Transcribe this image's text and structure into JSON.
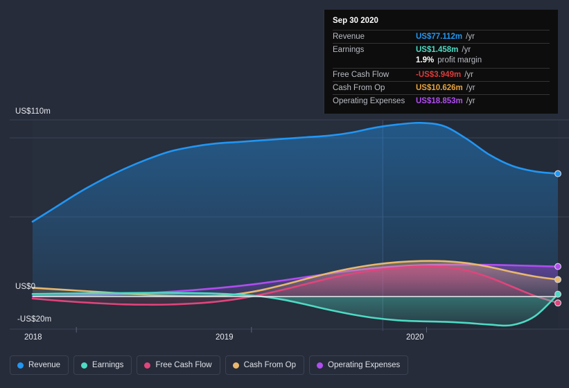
{
  "chart_data": {
    "type": "area",
    "title": "",
    "xlabel": "",
    "ylabel": "",
    "grid": true,
    "legend_position": "bottom",
    "currency": "US$",
    "units": "m",
    "ylim": [
      -20,
      110
    ],
    "y_ticks": [
      {
        "label": "US$110m",
        "value": 110
      },
      {
        "label": "US$0",
        "value": 0
      },
      {
        "label": "-US$20m",
        "value": -20
      }
    ],
    "x_ticks": [
      {
        "label": "2018",
        "value": 2018
      },
      {
        "label": "2019",
        "value": 2019
      },
      {
        "label": "2020",
        "value": 2020
      }
    ],
    "x_range": [
      "2017-10",
      "2020-09"
    ],
    "forecast_divider_x": 2019.75,
    "series": [
      {
        "name": "Revenue",
        "color": "#2196f3",
        "last_value": 77.112,
        "values": [
          47,
          56,
          65,
          73,
          80,
          86,
          91,
          94,
          96,
          97,
          98,
          99,
          100,
          101,
          103,
          106,
          108,
          109,
          107,
          99,
          89,
          82,
          78.5,
          77.112
        ]
      },
      {
        "name": "Earnings",
        "color": "#4ddbc4",
        "last_value": 1.458,
        "values": [
          1.6,
          1.8,
          2.0,
          2.1,
          2.2,
          2.3,
          2.3,
          2.2,
          1.9,
          1.2,
          0.1,
          -2.0,
          -5.0,
          -8.2,
          -11.0,
          -13.2,
          -14.6,
          -15.2,
          -15.5,
          -16.2,
          -17.2,
          -17.5,
          -12.0,
          1.458
        ]
      },
      {
        "name": "Free Cash Flow",
        "color": "#e0457b",
        "last_value": -3.949,
        "values": [
          -1.2,
          -2.4,
          -3.4,
          -4.2,
          -4.8,
          -5.0,
          -4.9,
          -4.3,
          -3.2,
          -1.4,
          1.2,
          4.4,
          8.0,
          11.5,
          14.4,
          16.6,
          18.1,
          18.9,
          18.6,
          16.4,
          12.0,
          6.2,
          0.4,
          -3.949
        ]
      },
      {
        "name": "Cash From Op",
        "color": "#e8b86d",
        "last_value": 10.626,
        "values": [
          5.5,
          4.6,
          3.7,
          2.8,
          1.9,
          1.1,
          0.5,
          0.2,
          0.4,
          1.6,
          4.0,
          7.4,
          11.2,
          14.8,
          17.8,
          20.1,
          21.6,
          22.3,
          22.2,
          21.0,
          18.6,
          15.4,
          12.6,
          10.626
        ]
      },
      {
        "name": "Operating Expenses",
        "color": "#b04df0",
        "last_value": 18.853,
        "values": [
          0.2,
          0.4,
          0.7,
          1.1,
          1.6,
          2.2,
          3.0,
          4.0,
          5.2,
          6.6,
          8.3,
          10.2,
          12.3,
          14.4,
          16.3,
          17.9,
          19.0,
          19.7,
          20.0,
          20.0,
          19.9,
          19.6,
          19.2,
          18.853
        ]
      }
    ]
  },
  "tooltip": {
    "date": "Sep 30 2020",
    "rows": [
      {
        "key": "Revenue",
        "value": "US$77.112m",
        "unit": "/yr",
        "color": "#2196f3"
      },
      {
        "key": "Earnings",
        "value": "US$1.458m",
        "unit": "/yr",
        "color": "#4ddbc4"
      },
      {
        "key": "Free Cash Flow",
        "value": "-US$3.949m",
        "unit": "/yr",
        "color": "#e03b3b"
      },
      {
        "key": "Cash From Op",
        "value": "US$10.626m",
        "unit": "/yr",
        "color": "#e8a33d"
      },
      {
        "key": "Operating Expenses",
        "value": "US$18.853m",
        "unit": "/yr",
        "color": "#b04df0"
      }
    ],
    "profit_margin_value": "1.9%",
    "profit_margin_label": "profit margin"
  },
  "legend": {
    "items": [
      {
        "label": "Revenue",
        "color": "#2196f3"
      },
      {
        "label": "Earnings",
        "color": "#4ddbc4"
      },
      {
        "label": "Free Cash Flow",
        "color": "#e0457b"
      },
      {
        "label": "Cash From Op",
        "color": "#e8b86d"
      },
      {
        "label": "Operating Expenses",
        "color": "#b04df0"
      }
    ]
  },
  "axis": {
    "y_top_label": "US$110m",
    "y_zero_label": "US$0",
    "y_bottom_label": "-US$20m",
    "x_2018": "2018",
    "x_2019": "2019",
    "x_2020": "2020"
  }
}
